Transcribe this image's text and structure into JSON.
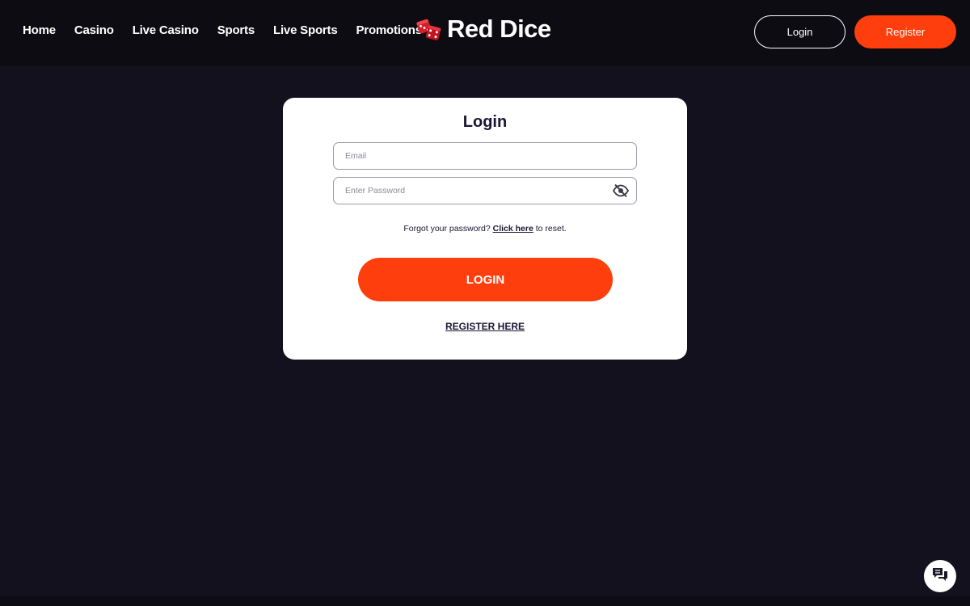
{
  "header": {
    "nav": [
      {
        "label": "Home"
      },
      {
        "label": "Casino"
      },
      {
        "label": "Live Casino"
      },
      {
        "label": "Sports"
      },
      {
        "label": "Live Sports"
      },
      {
        "label": "Promotions"
      }
    ],
    "logo_text": "Red Dice",
    "logo_icon": "dice-icon",
    "login_label": "Login",
    "register_label": "Register"
  },
  "login_card": {
    "title": "Login",
    "email_placeholder": "Email",
    "password_placeholder": "Enter Password",
    "password_toggle_icon": "eye-off-icon",
    "forgot_prefix": "Forgot your password?",
    "forgot_link": "Click here",
    "forgot_suffix": "to reset.",
    "login_button": "LOGIN",
    "register_link": "REGISTER HERE"
  },
  "chat": {
    "icon": "chat-bubbles-icon"
  },
  "colors": {
    "accent": "#ff3e0d",
    "background": "#13111e",
    "header_bg": "#0d0c12",
    "card_bg": "#ffffff",
    "text_dark": "#1a1633"
  }
}
